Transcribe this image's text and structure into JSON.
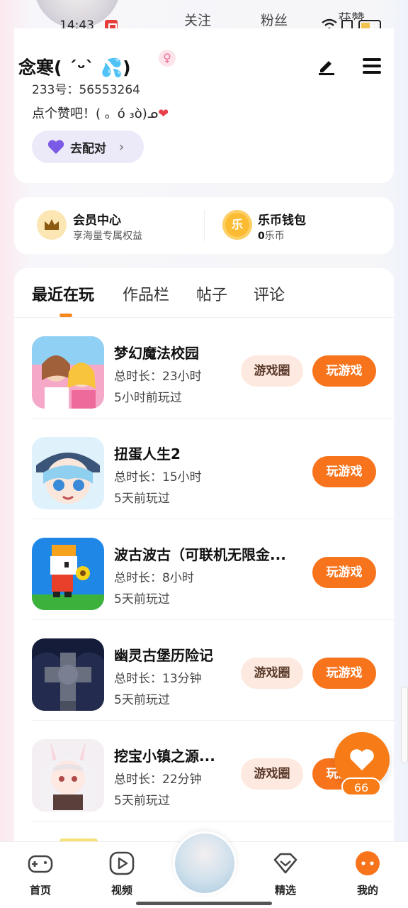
{
  "status_bar": {
    "time": "14:43"
  },
  "profile": {
    "stats_partial": [
      "关注",
      "粉丝",
      "获赞"
    ],
    "username": "念寒( ´ᵕ` 💦)",
    "uid_label": "233号：56553264",
    "bio": "点个赞吧！( 。ó ₃ò)ᓄ",
    "bio_heart": "❤",
    "pair_button": "去配对"
  },
  "member": {
    "vip_title": "会员中心",
    "vip_sub": "享海量专属权益",
    "coin_glyph": "乐",
    "wallet_title": "乐币钱包",
    "wallet_count": "0",
    "wallet_unit": "乐币"
  },
  "tabs": [
    "最近在玩",
    "作品栏",
    "帖子",
    "评论"
  ],
  "buttons": {
    "circle": "游戏圈",
    "play": "玩游戏"
  },
  "games": [
    {
      "name": "梦幻魔法校园",
      "time": "总时长：23小时",
      "last": "5小时前玩过",
      "has_circle": true,
      "icon": "magic-school-icon"
    },
    {
      "name": "扭蛋人生2",
      "time": "总时长：15小时",
      "last": "5天前玩过",
      "has_circle": false,
      "icon": "gacha-life-icon"
    },
    {
      "name": "波古波古（可联机无限金...",
      "time": "总时长：8小时",
      "last": "5天前玩过",
      "has_circle": false,
      "icon": "pogo-icon"
    },
    {
      "name": "幽灵古堡历险记",
      "time": "总时长：13分钟",
      "last": "5天前玩过",
      "has_circle": true,
      "icon": "ghost-castle-icon"
    },
    {
      "name": "挖宝小镇之源...",
      "time": "总时长：22分钟",
      "last": "5天前玩过",
      "has_circle": true,
      "icon": "treasure-town-icon"
    }
  ],
  "like_fab": {
    "count": "66"
  },
  "nav": [
    "首页",
    "视频",
    "精选",
    "我的"
  ],
  "colors": {
    "accent": "#f7731c",
    "circle_bg": "#fde9df",
    "indicator": "#f7881d",
    "pair_bg": "#eceaf8"
  }
}
